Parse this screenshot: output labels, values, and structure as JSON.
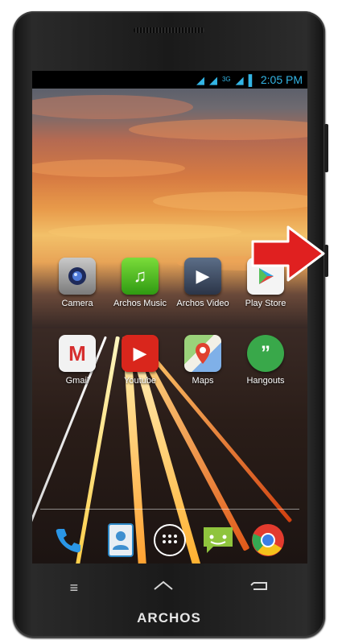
{
  "device": {
    "brand": "ARCHOS"
  },
  "status_bar": {
    "time": "2:05 PM",
    "network": "3G"
  },
  "apps_row1": [
    {
      "label": "Camera",
      "icon": "camera-icon"
    },
    {
      "label": "Archos Music",
      "icon": "music-icon"
    },
    {
      "label": "Archos Video",
      "icon": "video-icon"
    },
    {
      "label": "Play Store",
      "icon": "play-store-icon"
    }
  ],
  "apps_row2": [
    {
      "label": "Gmail",
      "icon": "gmail-icon"
    },
    {
      "label": "Youtube",
      "icon": "youtube-icon"
    },
    {
      "label": "Maps",
      "icon": "maps-icon"
    },
    {
      "label": "Hangouts",
      "icon": "hangouts-icon"
    }
  ],
  "dock": [
    "phone-icon",
    "contacts-icon",
    "app-drawer-icon",
    "messaging-icon",
    "chrome-icon"
  ],
  "nav": [
    "menu-icon",
    "home-icon",
    "back-icon"
  ],
  "colors": {
    "status_accent": "#33b5e5",
    "arrow_red": "#e02020"
  }
}
